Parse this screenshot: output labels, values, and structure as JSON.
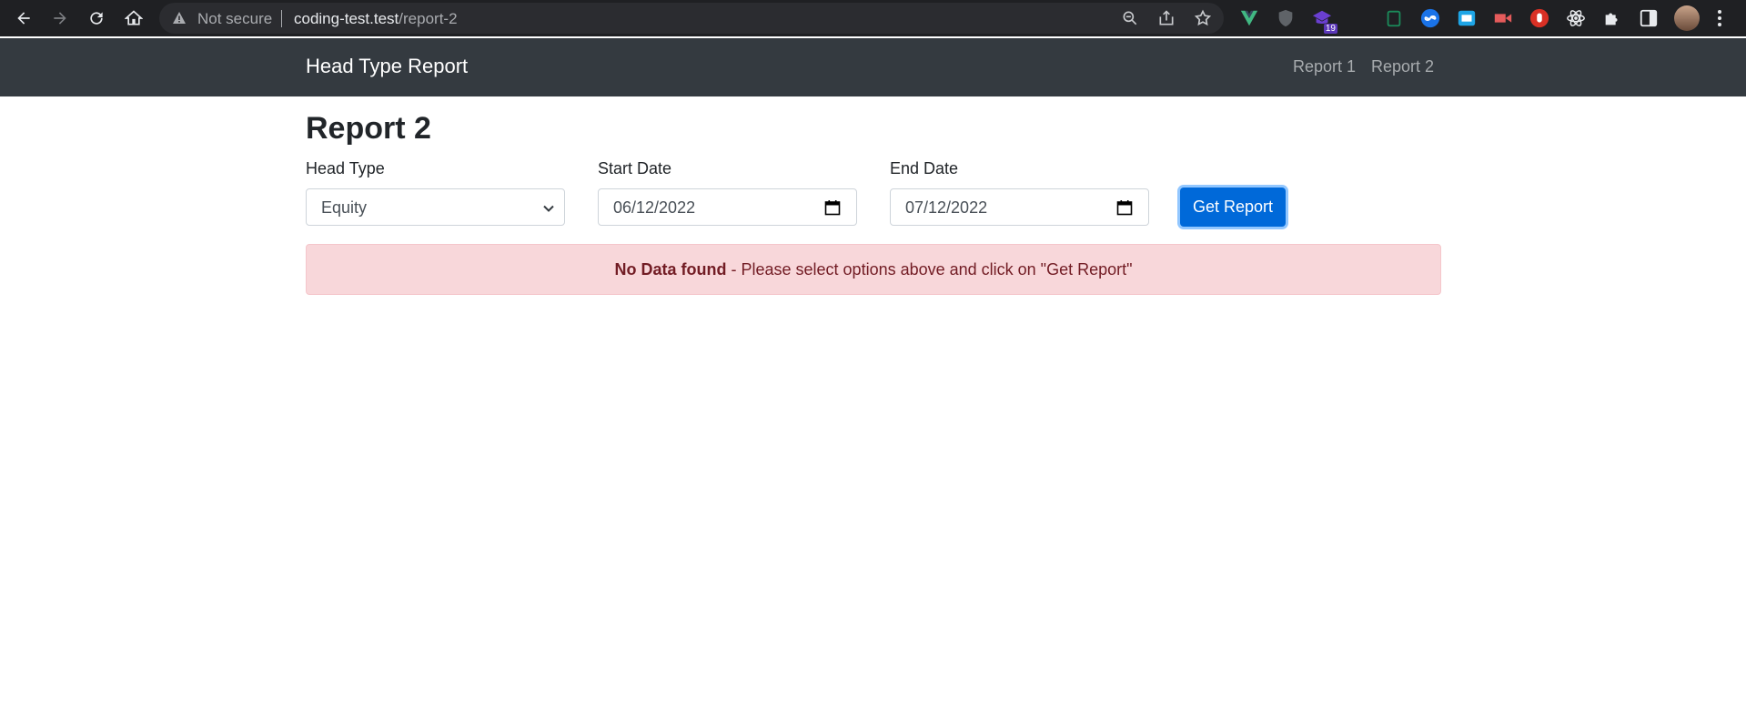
{
  "browser": {
    "not_secure": "Not secure",
    "url_host": "coding-test.test",
    "url_path": "/report-2",
    "extension_badge": "19"
  },
  "navbar": {
    "brand": "Head Type Report",
    "links": [
      "Report 1",
      "Report 2"
    ]
  },
  "page": {
    "title": "Report 2",
    "head_type": {
      "label": "Head Type",
      "value": "Equity"
    },
    "start_date": {
      "label": "Start Date",
      "value": "06/12/2022"
    },
    "end_date": {
      "label": "End Date",
      "value": "07/12/2022"
    },
    "submit_label": "Get Report",
    "alert": {
      "strong": "No Data found",
      "message": " - Please select options above and click on \"Get Report\""
    }
  },
  "colors": {
    "navbar_bg": "#343a40",
    "primary": "#0069d9",
    "alert_bg": "#f8d7da",
    "alert_text": "#721c24"
  }
}
